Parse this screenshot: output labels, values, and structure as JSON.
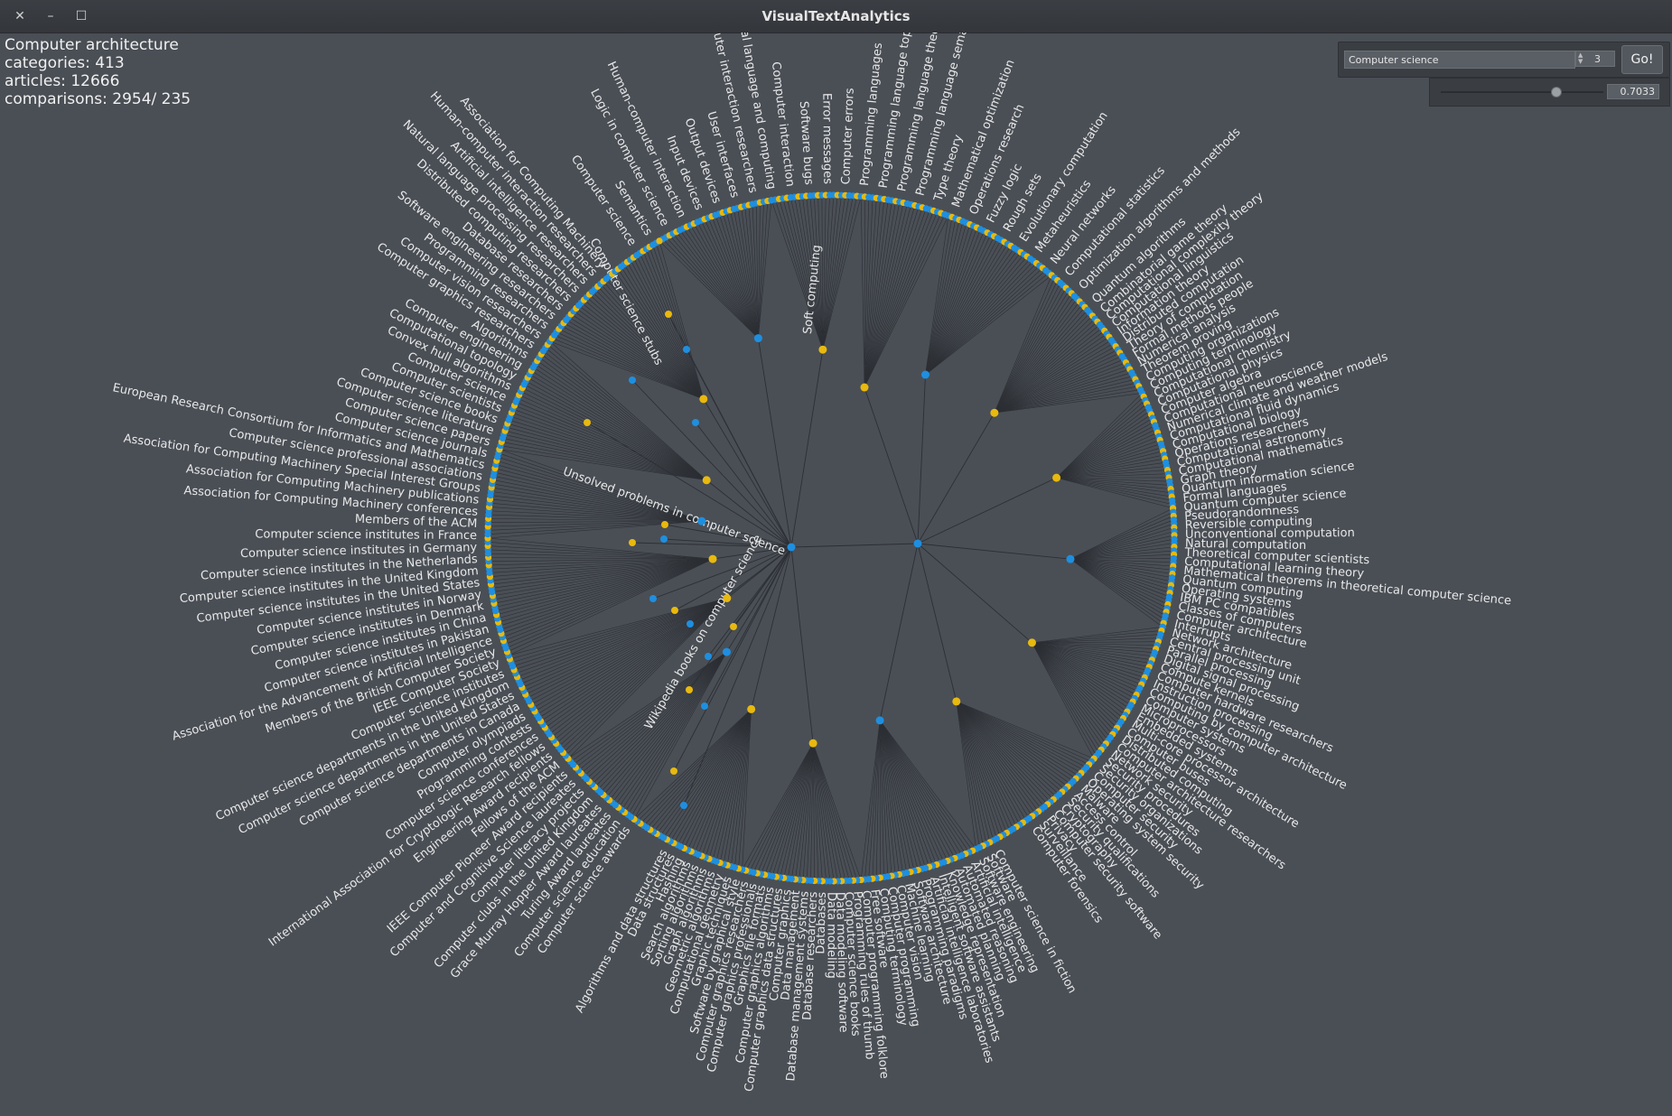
{
  "window": {
    "title": "VisualTextAnalytics"
  },
  "info": {
    "title": "Computer architecture",
    "categories": "categories: 413",
    "articles": "articles: 12666",
    "comparisons": "comparisons: 2954/ 235"
  },
  "controls": {
    "search_value": "Computer science",
    "spin_value": "3",
    "go_label": "Go!",
    "threshold_value": "0.7033",
    "threshold_fraction": 0.7033
  },
  "colors": {
    "background": "#4a4f56",
    "node_blue": "#1e8fe0",
    "node_yellow": "#e8b90e",
    "edge": "#2c2f34",
    "label": "#e8e8e8"
  },
  "graph": {
    "inner_labels": [
      "Soft computing",
      "Unsolved problems in computer science",
      "Wikipedia books on computer science",
      "Computer science stubs"
    ],
    "right_labels": [
      "Combinatorial game theory",
      "Computational complexity theory",
      "Computational linguistics",
      "Information theory",
      "Distributed computation",
      "Theory of computation",
      "Formal methods people",
      "Numerical analysis",
      "Theorem proving",
      "Computing organizations",
      "Computing terminology",
      "Computational chemistry",
      "Computational physics",
      "Computer algebra",
      "Computational neuroscience",
      "Numerical climate and weather models",
      "Computational fluid dynamics",
      "Computational biology",
      "Operations researchers",
      "Computational astronomy",
      "Computational mathematics",
      "Graph theory",
      "Quantum information science",
      "Formal languages",
      "Quantum computer science",
      "Pseudorandomness",
      "Reversible computing",
      "Unconventional computation",
      "Natural computation",
      "Theoretical computer scientists",
      "Computational learning theory",
      "Mathematical theorems in theoretical computer science",
      "Quantum computing",
      "Operating systems",
      "IBM PC compatibles",
      "Classes of computers",
      "Computer architecture",
      "Interrupts",
      "Network architecture",
      "Central processing unit",
      "Parallel processing",
      "Digital signal processing",
      "Compute kernels",
      "Computer hardware researchers",
      "Instruction processing",
      "Computing by computer architecture",
      "Computer systems",
      "Microprocessors",
      "Embedded systems",
      "Multi-core processor architecture",
      "Computer buses",
      "Distributed computing",
      "Computer architecture researchers",
      "Network security",
      "Security procedures",
      "Security organizations",
      "Computer security",
      "Operating system security",
      "Malware",
      "Access control",
      "Security qualifications",
      "Cryptography",
      "Computer security software",
      "Privacy",
      "Surveillance",
      "Computer forensics"
    ],
    "left_labels": [
      "Computer science awards",
      "Computer science education",
      "Turing Award laureates",
      "Grace Murray Hopper Award laureates",
      "Computer clubs in the United Kingdom",
      "Computer literacy projects",
      "Computer and Cognitive Science laureates",
      "IEEE Computer Pioneer Award recipients",
      "Fellows of the ACM",
      "Engineering Award recipients",
      "International Association for Cryptologic Research fellows",
      "Computer science conferences",
      "Programming contests",
      "Computer olympiads",
      "Computer science departments in Canada",
      "Computer science departments in the United States",
      "Computer science departments in the United Kingdom",
      "Computer science institutes",
      "IEEE Computer Society",
      "Members of the British Computer Society",
      "Association for the Advancement of Artificial Intelligence",
      "Computer science institutes in Pakistan",
      "Computer science institutes in China",
      "Computer science institutes in Denmark",
      "Computer science institutes in Norway",
      "Computer science institutes in the United States",
      "Computer science institutes in the United Kingdom",
      "Computer science institutes in the Netherlands",
      "Computer science institutes in Germany",
      "Computer science institutes in France",
      "Members of the ACM",
      "Association for Computing Machinery conferences",
      "Association for Computing Machinery publications",
      "Association for Computing Machinery Special Interest Groups",
      "Computer science professional associations",
      "European Research Consortium for Informatics and Mathematics",
      "Computer science journals",
      "Computer science papers",
      "Computer science literature",
      "Computer science books",
      "Computer scientists",
      "Computer science",
      "Convex hull algorithms",
      "Computational topology",
      "Computer engineering",
      "Algorithms",
      "Computer graphics researchers",
      "Computer vision researchers",
      "Programming researchers",
      "Software engineering researchers",
      "Database researchers",
      "Distributed computing researchers",
      "Natural language processing researchers",
      "Artificial intelligence researchers",
      "Human-computer interaction researchers",
      "Association for Computing Machinery"
    ],
    "top_labels": [
      "Computer science",
      "Semantics",
      "Logic in computer science",
      "Human-computer interaction",
      "Input devices",
      "Output devices",
      "User interfaces",
      "Human-computer interaction researchers",
      "Natural language and computing",
      "Computer interaction",
      "Software bugs",
      "Error messages",
      "Computer errors",
      "Programming languages",
      "Programming language topics",
      "Programming language theory",
      "Programming language semantics",
      "Type theory",
      "Mathematical optimization",
      "Operations research",
      "Fuzzy logic",
      "Rough sets",
      "Evolutionary computation",
      "Metaheuristics",
      "Neural networks",
      "Computational statistics",
      "Optimization algorithms and methods",
      "Quantum algorithms"
    ],
    "bottom_labels": [
      "Computer science in fiction",
      "Software",
      "Software engineering",
      "Artificial intelligence",
      "Automated reasoning",
      "Automated planning",
      "Knowledge representation",
      "Intelligent software assistants",
      "Artificial intelligence laboratories",
      "Programming paradigms",
      "Software architecture",
      "Machine learning",
      "Computer vision",
      "Computer programming",
      "Computing terminology",
      "Free software",
      "Computer programming folklore",
      "Programming rules of thumb",
      "Computer science books",
      "Data modeling software",
      "Data modeling",
      "Databases",
      "Database researchers",
      "Database management systems",
      "Data management",
      "Computer graphics",
      "Computer graphics data structures",
      "Computer graphics algorithms",
      "Graphics file formats",
      "Computer graphics professionals",
      "Computer graphics researchers",
      "Software by graphical style",
      "Graphic techniques",
      "Computational geometry",
      "Geometric algorithms",
      "Graph algorithms",
      "Sorting algorithms",
      "Search algorithms",
      "Hashing",
      "Data structures",
      "Algorithms and data structures"
    ]
  }
}
